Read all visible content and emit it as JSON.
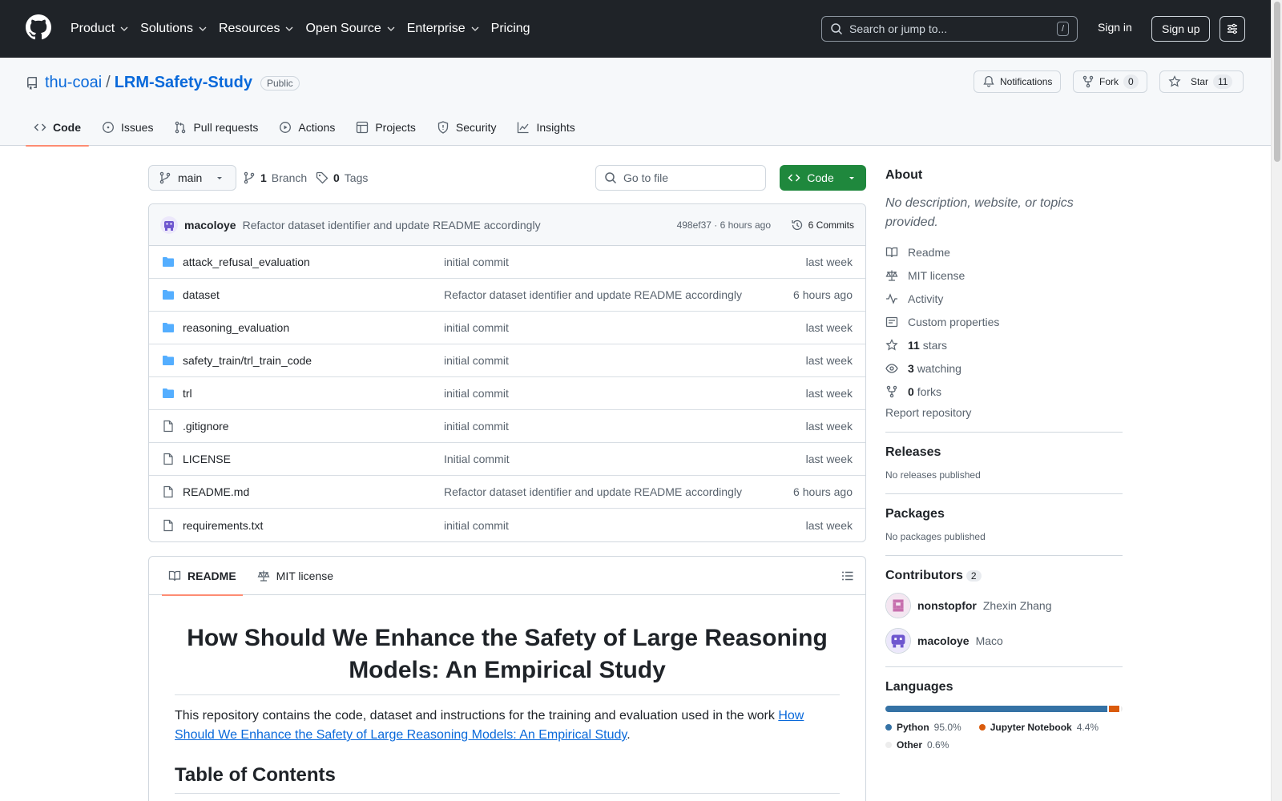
{
  "topnav": {
    "items": [
      {
        "label": "Product",
        "dropdown": true
      },
      {
        "label": "Solutions",
        "dropdown": true
      },
      {
        "label": "Resources",
        "dropdown": true
      },
      {
        "label": "Open Source",
        "dropdown": true
      },
      {
        "label": "Enterprise",
        "dropdown": true
      },
      {
        "label": "Pricing",
        "dropdown": false
      }
    ],
    "search_placeholder": "Search or jump to...",
    "search_shortcut": "/",
    "signin": "Sign in",
    "signup": "Sign up"
  },
  "repo": {
    "owner": "thu-coai",
    "separator": "/",
    "name": "LRM-Safety-Study",
    "visibility": "Public",
    "notifications_label": "Notifications",
    "fork_label": "Fork",
    "fork_count": "0",
    "star_label": "Star",
    "star_count": "11",
    "tabs": [
      {
        "label": "Code",
        "icon": "code-icon",
        "active": true
      },
      {
        "label": "Issues",
        "icon": "issue-icon",
        "active": false
      },
      {
        "label": "Pull requests",
        "icon": "pull-request-icon",
        "active": false
      },
      {
        "label": "Actions",
        "icon": "play-icon",
        "active": false
      },
      {
        "label": "Projects",
        "icon": "table-icon",
        "active": false
      },
      {
        "label": "Security",
        "icon": "shield-icon",
        "active": false
      },
      {
        "label": "Insights",
        "icon": "graph-icon",
        "active": false
      }
    ]
  },
  "toolbar": {
    "branch": "main",
    "branch_count": "1",
    "branch_label": "Branch",
    "tag_count": "0",
    "tag_label": "Tags",
    "goto_placeholder": "Go to file",
    "code_button": "Code"
  },
  "commit": {
    "author": "macoloye",
    "message": "Refactor dataset identifier and update README accordingly",
    "meta": "498ef37 · 6 hours ago",
    "commits_label": "6 Commits"
  },
  "files": [
    {
      "name": "attack_refusal_evaluation",
      "type": "folder",
      "message": "initial commit",
      "date": "last week"
    },
    {
      "name": "dataset",
      "type": "folder",
      "message": "Refactor dataset identifier and update README accordingly",
      "date": "6 hours ago"
    },
    {
      "name": "reasoning_evaluation",
      "type": "folder",
      "message": "initial commit",
      "date": "last week"
    },
    {
      "name": "safety_train/trl_train_code",
      "type": "folder",
      "message": "initial commit",
      "date": "last week"
    },
    {
      "name": "trl",
      "type": "folder",
      "message": "initial commit",
      "date": "last week"
    },
    {
      "name": ".gitignore",
      "type": "file",
      "message": "initial commit",
      "date": "last week"
    },
    {
      "name": "LICENSE",
      "type": "file",
      "message": "Initial commit",
      "date": "last week"
    },
    {
      "name": "README.md",
      "type": "file",
      "message": "Refactor dataset identifier and update README accordingly",
      "date": "6 hours ago"
    },
    {
      "name": "requirements.txt",
      "type": "file",
      "message": "initial commit",
      "date": "last week"
    }
  ],
  "readme": {
    "tab_readme": "README",
    "tab_license": "MIT license",
    "title": "How Should We Enhance the Safety of Large Reasoning Models: An Empirical Study",
    "intro": "This repository contains the code, dataset and instructions for the training and evaluation used in the work ",
    "intro_link": "How Should We Enhance the Safety of Large Reasoning Models: An Empirical Study",
    "intro_end": ".",
    "toc_heading": "Table of Contents"
  },
  "about": {
    "heading": "About",
    "description": "No description, website, or topics provided.",
    "items": [
      {
        "icon": "book-icon",
        "bold": "",
        "label": "Readme"
      },
      {
        "icon": "law-icon",
        "bold": "",
        "label": "MIT license"
      },
      {
        "icon": "pulse-icon",
        "bold": "",
        "label": "Activity"
      },
      {
        "icon": "note-icon",
        "bold": "",
        "label": "Custom properties"
      },
      {
        "icon": "star-icon",
        "bold": "11",
        "label": "stars"
      },
      {
        "icon": "eye-icon",
        "bold": "3",
        "label": "watching"
      },
      {
        "icon": "fork-icon",
        "bold": "0",
        "label": "forks"
      }
    ],
    "report": "Report repository"
  },
  "releases": {
    "heading": "Releases",
    "text": "No releases published"
  },
  "packages": {
    "heading": "Packages",
    "text": "No packages published"
  },
  "contributors": {
    "heading": "Contributors",
    "count": "2",
    "list": [
      {
        "login": "nonstopfor",
        "name": "Zhexin Zhang"
      },
      {
        "login": "macoloye",
        "name": "Maco"
      }
    ]
  },
  "languages": {
    "heading": "Languages",
    "list": [
      {
        "name": "Python",
        "pct": "95.0%",
        "value": 95.0,
        "color": "#3572A5"
      },
      {
        "name": "Jupyter Notebook",
        "pct": "4.4%",
        "value": 4.4,
        "color": "#DA5B0B"
      },
      {
        "name": "Other",
        "pct": "0.6%",
        "value": 0.6,
        "color": "#ededed"
      }
    ]
  }
}
